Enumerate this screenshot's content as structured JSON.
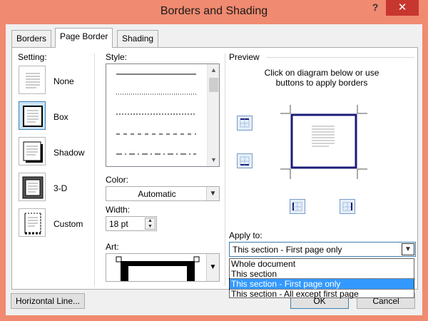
{
  "window": {
    "title": "Borders and Shading",
    "help_label": "?",
    "close_label": "✕"
  },
  "tabs": [
    {
      "label": "Borders"
    },
    {
      "label": "Page Border"
    },
    {
      "label": "Shading"
    }
  ],
  "setting": {
    "label": "Setting:",
    "options": [
      {
        "label": "None",
        "icon": "none-setting-icon"
      },
      {
        "label": "Box",
        "icon": "box-setting-icon",
        "selected": true
      },
      {
        "label": "Shadow",
        "icon": "shadow-setting-icon"
      },
      {
        "label": "3-D",
        "icon": "3d-setting-icon"
      },
      {
        "label": "Custom",
        "icon": "custom-setting-icon"
      }
    ]
  },
  "style": {
    "label": "Style:"
  },
  "color": {
    "label": "Color:",
    "value": "Automatic"
  },
  "width": {
    "label": "Width:",
    "value": "18 pt"
  },
  "art": {
    "label": "Art:"
  },
  "preview": {
    "label": "Preview",
    "instructions_line1": "Click on diagram below or use",
    "instructions_line2": "buttons to apply borders",
    "border_color": "#1c1c7a"
  },
  "apply_to": {
    "label": "Apply to:",
    "value": "This section - First page only",
    "options": [
      {
        "label": "Whole document"
      },
      {
        "label": "This section"
      },
      {
        "label": "This section - First page only",
        "selected": true
      },
      {
        "label": "This section - All except first page"
      }
    ]
  },
  "buttons": {
    "horizontal_line": "Horizontal Line...",
    "ok": "OK",
    "cancel": "Cancel"
  },
  "colors": {
    "title_bar": "#f08a70",
    "close": "#c7372f",
    "selection": "#3399ff"
  }
}
